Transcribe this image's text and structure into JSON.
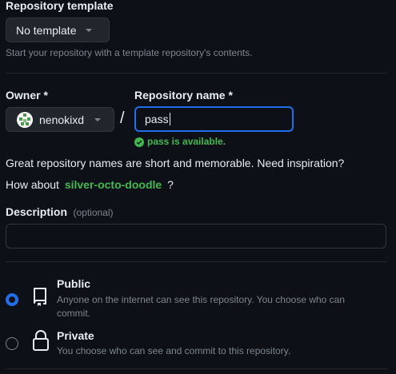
{
  "template": {
    "label": "Repository template",
    "selected": "No template",
    "hint": "Start your repository with a template repository's contents."
  },
  "owner": {
    "label": "Owner *",
    "value": "nenokixd"
  },
  "separator": "/",
  "repo_name": {
    "label": "Repository name *",
    "value": "pass",
    "status": "pass is available."
  },
  "suggestion": {
    "line1": "Great repository names are short and memorable. Need inspiration?",
    "prefix": "How about",
    "name": "silver-octo-doodle",
    "suffix": "?"
  },
  "description": {
    "label": "Description",
    "optional": "(optional)",
    "value": ""
  },
  "visibility": {
    "public_title": "Public",
    "public_desc": "Anyone on the internet can see this repository. You choose who can commit.",
    "private_title": "Private",
    "private_desc": "You choose who can see and commit to this repository.",
    "selected": "public"
  },
  "colors": {
    "accent": "#1f6feb",
    "success": "#3fb950",
    "link": "#3fb950"
  }
}
